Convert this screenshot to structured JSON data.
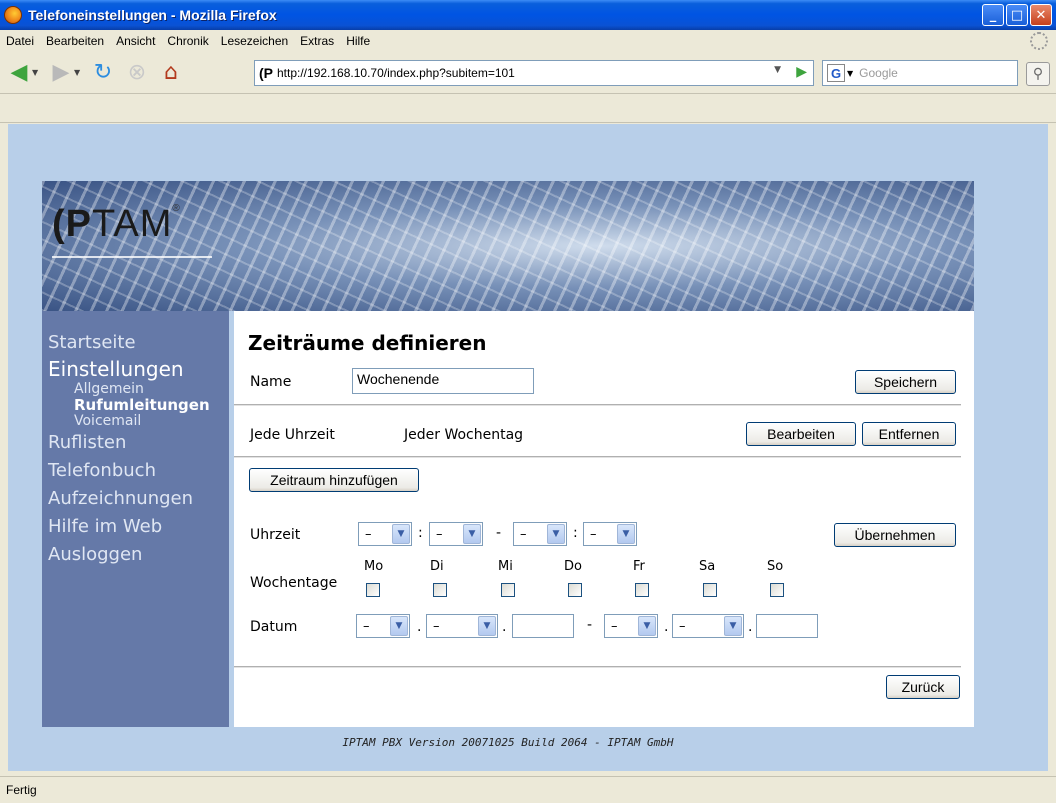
{
  "window": {
    "title": "Telefoneinstellungen - Mozilla Firefox"
  },
  "menu": [
    "Datei",
    "Bearbeiten",
    "Ansicht",
    "Chronik",
    "Lesezeichen",
    "Extras",
    "Hilfe"
  ],
  "nav": {
    "site_icon": "(P",
    "url": "http://192.168.10.70/index.php?subitem=101",
    "search_engine": "G",
    "search_placeholder": "Google"
  },
  "brand": {
    "logo_bold": "(P",
    "logo_rest": "TAM",
    "logo_mark": "®"
  },
  "sidebar": {
    "items": [
      {
        "label": "Startseite"
      },
      {
        "label": "Einstellungen"
      },
      {
        "label": "Ruflisten"
      },
      {
        "label": "Telefonbuch"
      },
      {
        "label": "Aufzeichnungen"
      },
      {
        "label": "Hilfe im Web"
      },
      {
        "label": "Ausloggen"
      }
    ],
    "sub": [
      {
        "label": "Allgemein"
      },
      {
        "label": "Rufumleitungen"
      },
      {
        "label": "Voicemail"
      }
    ]
  },
  "form": {
    "title": "Zeiträume definieren",
    "name_label": "Name",
    "name_value": "Wochenende",
    "save_button": "Speichern",
    "rule_time": "Jede Uhrzeit",
    "rule_day": "Jeder Wochentag",
    "edit_button": "Bearbeiten",
    "remove_button": "Entfernen",
    "add_button": "Zeitraum hinzufügen",
    "time_label": "Uhrzeit",
    "weekdays_label": "Wochentage",
    "date_label": "Datum",
    "apply_button": "Übernehmen",
    "back_button": "Zurück",
    "select_placeholder": "–",
    "days": [
      "Mo",
      "Di",
      "Mi",
      "Do",
      "Fr",
      "Sa",
      "So"
    ]
  },
  "footer": "IPTAM PBX Version 20071025 Build 2064 - IPTAM GmbH",
  "status": "Fertig"
}
